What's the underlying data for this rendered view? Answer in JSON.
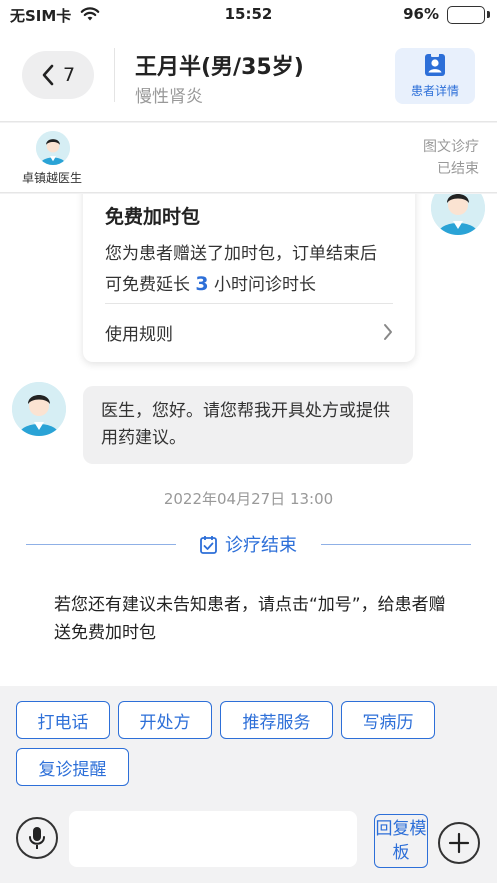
{
  "status_bar": {
    "carrier": "无SIM卡",
    "time": "15:52",
    "battery": "96%"
  },
  "nav": {
    "back_count": "7",
    "patient_name": "王月半(男/35岁)",
    "diagnosis": "慢性肾炎",
    "detail_label": "患者详情"
  },
  "info": {
    "doctor_name": "卓镇越医生",
    "consult_type": "图文诊疗",
    "consult_status": "已结束"
  },
  "card": {
    "title": "免费加时包",
    "body_prefix": "您为患者赠送了加时包，订单结束后可免费延长",
    "hours": "3",
    "body_suffix": "小时问诊时长",
    "rule_label": "使用规则"
  },
  "message": {
    "text": "医生，您好。请您帮我开具处方或提供用药建议。"
  },
  "timestamp": "2022年04月27日 13:00",
  "end_label": "诊疗结束",
  "notice": "若您还有建议未告知患者，请点击“加号”，给患者赠送免费加时包",
  "quick_actions": [
    "打电话",
    "开处方",
    "推荐服务",
    "写病历",
    "复诊提醒"
  ],
  "input": {
    "placeholder": "",
    "template_label": "回复模板"
  },
  "colors": {
    "accent": "#2d6fd8",
    "card_highlight": "#2d6fd8",
    "battery": "#3ac259"
  }
}
